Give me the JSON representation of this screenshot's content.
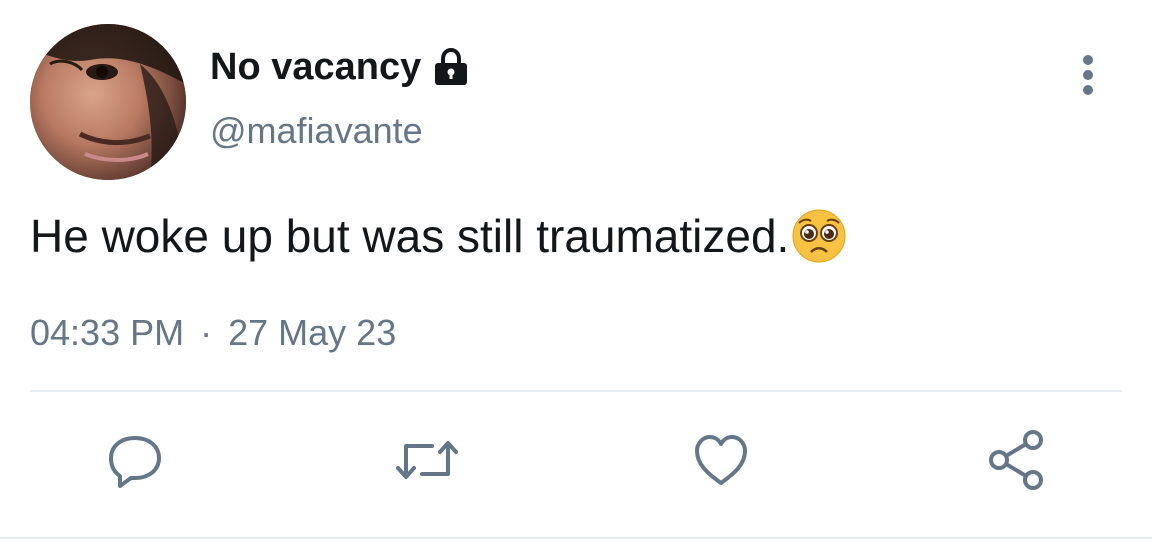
{
  "tweet": {
    "display_name": "No vacancy",
    "handle": "@mafiavante",
    "text": "He woke up but was still traumatized.",
    "time": "04:33 PM",
    "separator": "·",
    "date": "27 May 23"
  },
  "icons": {
    "protected": "lock-icon",
    "more": "vertical-ellipsis-icon",
    "emoji": "pleading-face-emoji",
    "reply": "reply-bubble-icon",
    "retweet": "retweet-icon",
    "like": "heart-icon",
    "share": "share-icon"
  },
  "colors": {
    "primary_text": "#14171a",
    "secondary_text": "#657786",
    "icon": "#657786",
    "divider": "#e6ecf0"
  }
}
